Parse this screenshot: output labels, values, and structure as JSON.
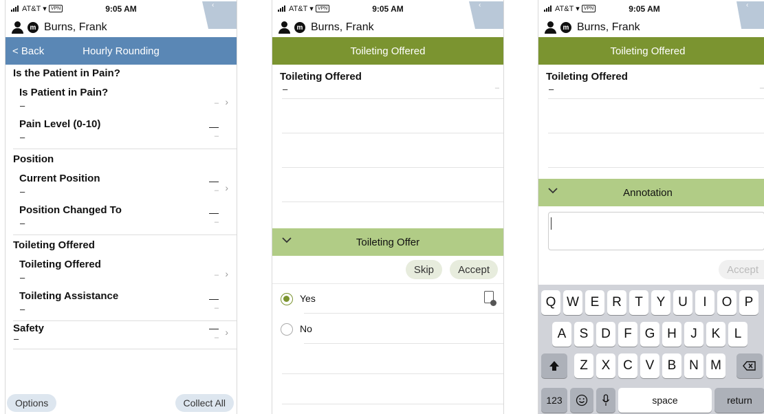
{
  "status_bar": {
    "carrier": "AT&T",
    "vpn": "VPN",
    "time": "9:05 AM"
  },
  "patient": {
    "badge": "m",
    "name": "Burns, Frank",
    "tab_glyph": "‹"
  },
  "screen1": {
    "back_label": "< Back",
    "title": "Hourly Rounding",
    "sections": [
      {
        "header": "Is the Patient in Pain?",
        "rows": [
          {
            "label": "Is Patient in Pain?",
            "value": "–",
            "right_value": "",
            "right_sub": "–",
            "chevron": true
          },
          {
            "label": "Pain Level  (0-10)",
            "value": "–",
            "right_value": "—",
            "right_sub": "–",
            "chevron": false
          }
        ]
      },
      {
        "header": "Position",
        "rows": [
          {
            "label": "Current Position",
            "value": "–",
            "right_value": "—",
            "right_sub": "–",
            "chevron": true
          },
          {
            "label": "Position Changed To",
            "value": "–",
            "right_value": "—",
            "right_sub": "–",
            "chevron": false
          }
        ]
      },
      {
        "header": "Toileting Offered",
        "rows": [
          {
            "label": "Toileting Offered",
            "value": "–",
            "right_value": "",
            "right_sub": "–",
            "chevron": true
          },
          {
            "label": "Toileting Assistance",
            "value": "–",
            "right_value": "—",
            "right_sub": "–",
            "chevron": false
          }
        ]
      }
    ],
    "safety": {
      "label": "Safety",
      "value": "–",
      "right_value": "—",
      "right_sub": "–"
    },
    "options_label": "Options",
    "collect_all_label": "Collect All"
  },
  "screen2": {
    "title": "Toileting Offered",
    "item_label": "Toileting Offered",
    "item_value": "–",
    "item_right": "–",
    "section_label": "Toileting Offer",
    "skip_label": "Skip",
    "accept_label": "Accept",
    "options": [
      {
        "label": "Yes",
        "selected": true
      },
      {
        "label": "No",
        "selected": false
      }
    ]
  },
  "screen3": {
    "title": "Toileting Offered",
    "item_label": "Toileting Offered",
    "item_value": "–",
    "item_right": "–",
    "section_label": "Annotation",
    "accept_label": "Accept",
    "keyboard": {
      "row1": [
        "Q",
        "W",
        "E",
        "R",
        "T",
        "Y",
        "U",
        "I",
        "O",
        "P"
      ],
      "row2": [
        "A",
        "S",
        "D",
        "F",
        "G",
        "H",
        "J",
        "K",
        "L"
      ],
      "row3": [
        "Z",
        "X",
        "C",
        "V",
        "B",
        "N",
        "M"
      ],
      "numbers_label": "123",
      "space_label": "space",
      "return_label": "return"
    }
  },
  "colors": {
    "nav_blue": "#5a87b5",
    "nav_olive": "#7b9430",
    "section_green": "#b1cc86"
  }
}
